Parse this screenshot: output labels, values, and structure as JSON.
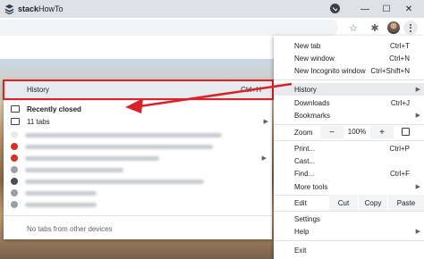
{
  "titlebar": {
    "tab_title_bold": "stack",
    "tab_title_light": "HowTo",
    "window_controls": [
      "—",
      "☐",
      "✕"
    ]
  },
  "toolbar": {
    "star_icon": "☆",
    "extension_icon": "✱"
  },
  "history_submenu": {
    "history_label": "History",
    "history_shortcut": "Ctrl+H",
    "recently_closed": "Recently closed",
    "tabs_count": "11 tabs",
    "no_tabs_label": "No tabs from other devices"
  },
  "menu": {
    "new_tab": {
      "label": "New tab",
      "shortcut": "Ctrl+T"
    },
    "new_window": {
      "label": "New window",
      "shortcut": "Ctrl+N"
    },
    "new_incognito": {
      "label": "New Incognito window",
      "shortcut": "Ctrl+Shift+N"
    },
    "history": {
      "label": "History"
    },
    "downloads": {
      "label": "Downloads",
      "shortcut": "Ctrl+J"
    },
    "bookmarks": {
      "label": "Bookmarks"
    },
    "zoom": {
      "label": "Zoom",
      "minus": "−",
      "value": "100%",
      "plus": "+"
    },
    "print": {
      "label": "Print...",
      "shortcut": "Ctrl+P"
    },
    "cast": {
      "label": "Cast..."
    },
    "find": {
      "label": "Find...",
      "shortcut": "Ctrl+F"
    },
    "more_tools": {
      "label": "More tools"
    },
    "edit": {
      "label": "Edit",
      "cut": "Cut",
      "copy": "Copy",
      "paste": "Paste"
    },
    "settings": {
      "label": "Settings"
    },
    "help": {
      "label": "Help"
    },
    "exit": {
      "label": "Exit"
    }
  },
  "colors": {
    "highlight_border": "#d9232a",
    "menu_active_bg": "#e8eaed"
  }
}
